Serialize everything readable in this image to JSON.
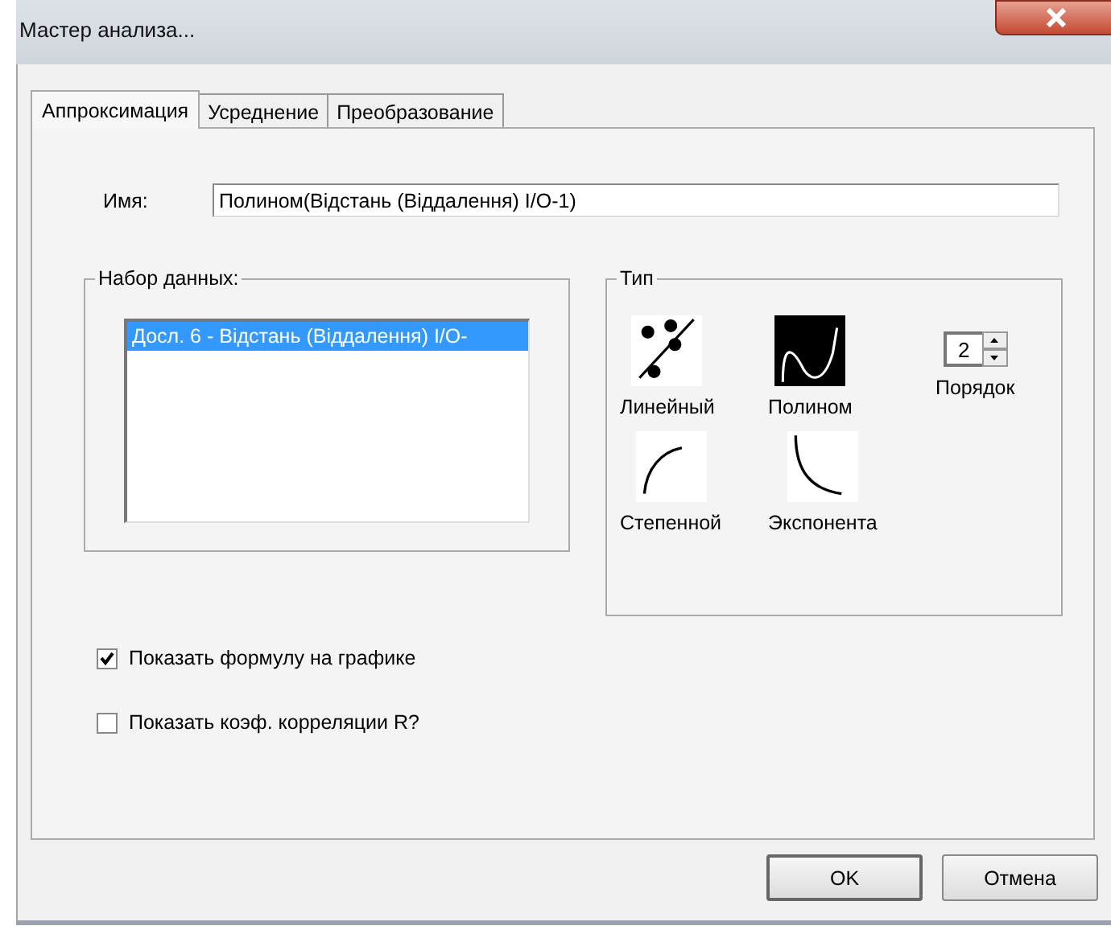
{
  "window": {
    "title": "Мастер анализа..."
  },
  "tabs": [
    {
      "label": "Аппроксимация",
      "selected": true
    },
    {
      "label": "Усреднение",
      "selected": false
    },
    {
      "label": "Преобразование",
      "selected": false
    }
  ],
  "name_field": {
    "label": "Имя:",
    "value": "Полином(Відстань (Віддалення) I/O-1)"
  },
  "dataset": {
    "title": "Набор данных:",
    "items": [
      {
        "label": "Досл. 6 - Відстань (Віддалення) I/O-",
        "selected": true
      }
    ]
  },
  "type_group": {
    "title": "Тип",
    "options": [
      {
        "kind": "linear",
        "label": "Линейный",
        "selected": false
      },
      {
        "kind": "polynomial",
        "label": "Полином",
        "selected": true
      },
      {
        "kind": "power",
        "label": "Степенной",
        "selected": false
      },
      {
        "kind": "exponent",
        "label": "Экспонента",
        "selected": false
      }
    ],
    "order": {
      "label": "Порядок",
      "value": "2"
    }
  },
  "checkboxes": [
    {
      "label": "Показать формулу на графике",
      "checked": true
    },
    {
      "label": "Показать коэф. корреляции R?",
      "checked": false
    }
  ],
  "buttons": [
    "OK",
    "Отмена"
  ]
}
